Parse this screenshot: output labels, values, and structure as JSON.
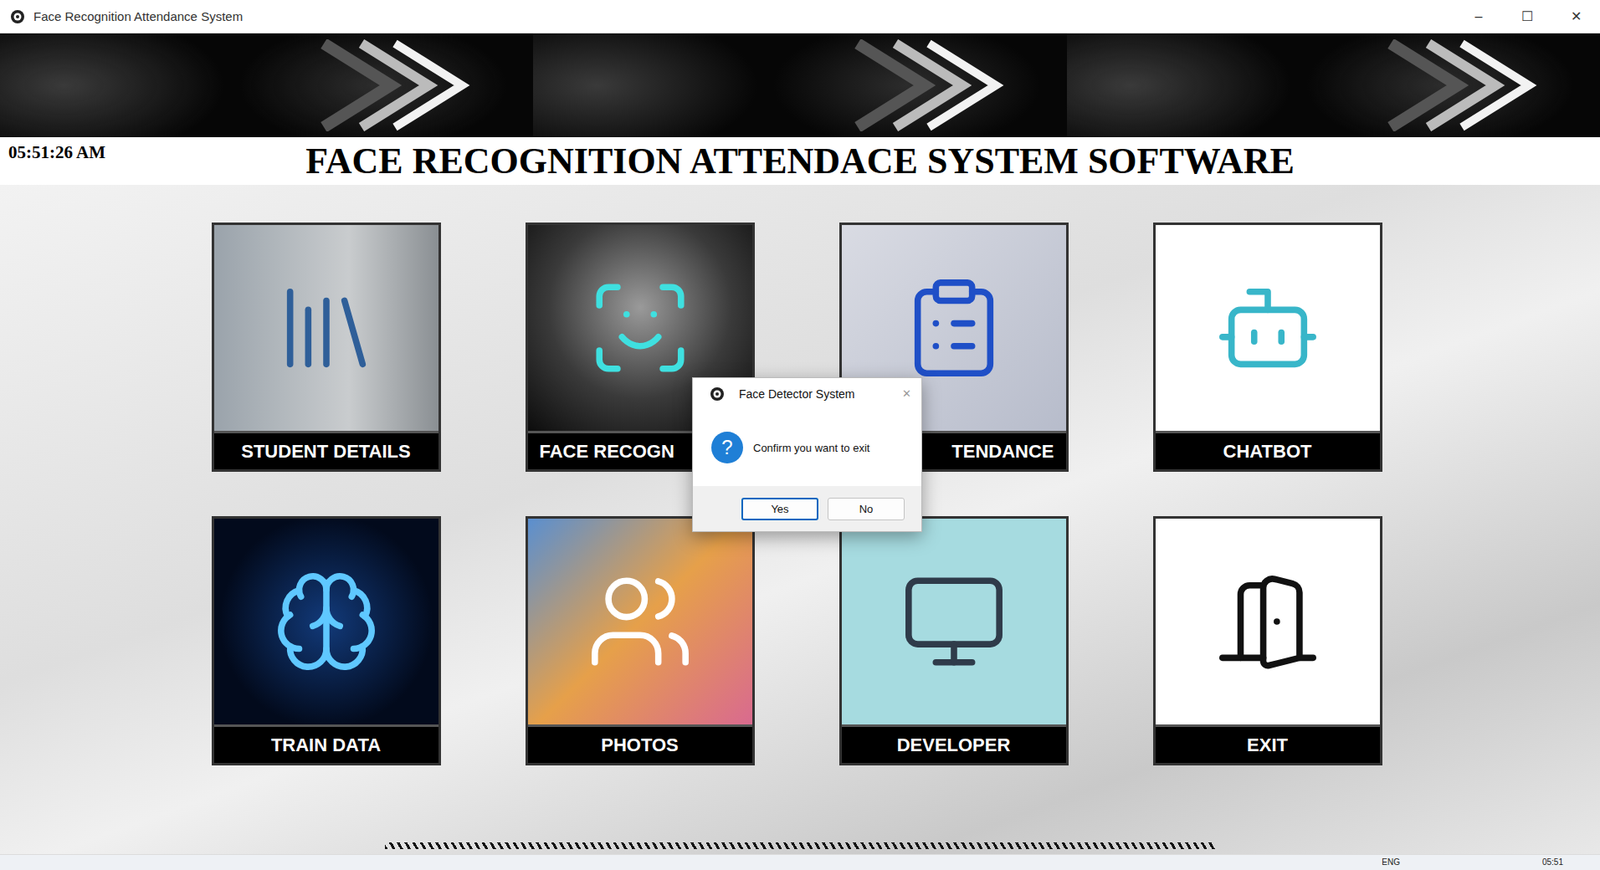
{
  "window": {
    "title": "Face Recognition Attendance System",
    "controls": [
      "–",
      "☐",
      "✕"
    ]
  },
  "header": {
    "clock": "05:51:26 AM",
    "title": "FACE RECOGNITION ATTENDACE SYSTEM SOFTWARE"
  },
  "tiles": [
    {
      "label": "STUDENT DETAILS",
      "truncated": "none"
    },
    {
      "label": "FACE RECOGN",
      "truncated": "end"
    },
    {
      "label": "TENDANCE",
      "truncated": "start"
    },
    {
      "label": "CHATBOT",
      "truncated": "none"
    },
    {
      "label": "TRAIN DATA",
      "truncated": "none"
    },
    {
      "label": "PHOTOS",
      "truncated": "none"
    },
    {
      "label": "DEVELOPER",
      "truncated": "none"
    },
    {
      "label": "EXIT",
      "truncated": "none"
    }
  ],
  "dialog": {
    "title": "Face Detector System",
    "close": "✕",
    "icon": "?",
    "message": "Confirm you want to exit",
    "buttons": [
      {
        "label": "Yes",
        "selected": true
      },
      {
        "label": "No",
        "selected": false
      }
    ]
  },
  "taskbar": {
    "language": "ENG",
    "time": "05:51"
  }
}
